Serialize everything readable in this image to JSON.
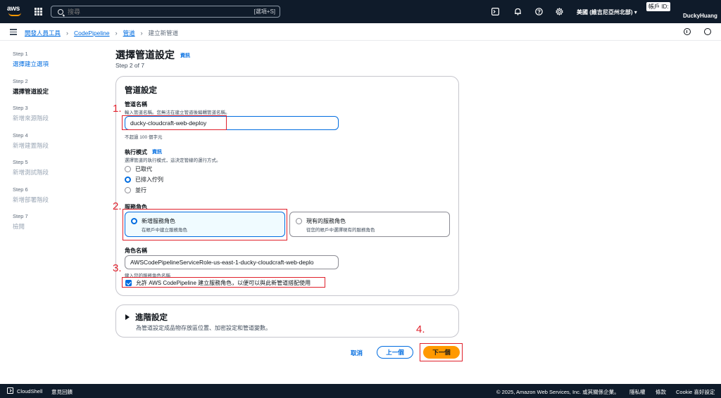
{
  "topnav": {
    "logo_text": "aws",
    "search_placeholder": "搜尋",
    "search_shortcut": "[選項+S]",
    "region": "美國 (維吉尼亞州北部) ▾",
    "account_label": "帳戶 ID:",
    "username": "DuckyHuang"
  },
  "breadcrumb": {
    "items": [
      "開發人員工具",
      "CodePipeline",
      "管道"
    ],
    "current": "建立新管道"
  },
  "steps": [
    {
      "num": "Step 1",
      "label": "選擇建立選項"
    },
    {
      "num": "Step 2",
      "label": "選擇管道設定"
    },
    {
      "num": "Step 3",
      "label": "新增來源階段"
    },
    {
      "num": "Step 4",
      "label": "新增建置階段"
    },
    {
      "num": "Step 5",
      "label": "新增測試階段"
    },
    {
      "num": "Step 6",
      "label": "新增部署階段"
    },
    {
      "num": "Step 7",
      "label": "檢閱"
    }
  ],
  "page": {
    "title": "選擇管道設定",
    "info": "資訊",
    "step_of": "Step 2 of 7"
  },
  "pipeline_settings": {
    "heading": "管道設定",
    "name_label": "管道名稱",
    "name_desc": "輸入管道名稱。您無法在建立管道後編輯管道名稱。",
    "name_value": "ducky-cloudcraft-web-deploy",
    "name_constraint": "不超過 100 個字元",
    "mode_label": "執行模式",
    "mode_info": "資訊",
    "mode_desc": "選擇管道的執行模式，這決定管線的運行方式。",
    "mode_options": [
      "已取代",
      "已排入佇列",
      "並行"
    ],
    "role_label": "服務角色",
    "role_new_title": "新增服務角色",
    "role_new_desc": "在帳戶中建立服務角色",
    "role_existing_title": "現有的服務角色",
    "role_existing_desc": "從您的帳戶中選擇現有的服務角色",
    "role_name_label": "角色名稱",
    "role_name_value": "AWSCodePipelineServiceRole-us-east-1-ducky-cloudcraft-web-deplo",
    "role_name_desc": "鍵入您的服務角色名稱",
    "allow_checkbox": "允許 AWS CodePipeline 建立服務角色，以便可以與此新管道搭配使用"
  },
  "advanced": {
    "title": "進階設定",
    "desc": "為管道設定成品物存放區位置、加密設定和管道變數。"
  },
  "actions": {
    "cancel": "取消",
    "previous": "上一個",
    "next": "下一個"
  },
  "annotations": [
    "1.",
    "2.",
    "3.",
    "4."
  ],
  "footer": {
    "cloudshell": "CloudShell",
    "feedback": "意見回饋",
    "copyright": "© 2025, Amazon Web Services, Inc. 或其關係企業。",
    "privacy": "隱私權",
    "terms": "條款",
    "cookie": "Cookie 喜好設定"
  },
  "colors": {
    "nav_bg": "#0f1b2a",
    "link": "#006ce0",
    "primary_button": "#ff9900",
    "annotation_red": "#e0202b"
  },
  "icons": [
    "grid-icon",
    "search-icon",
    "cloudshell-icon",
    "bell-icon",
    "help-icon",
    "gear-icon",
    "hamburger-icon",
    "info-icon",
    "clock-icon",
    "caret-right-icon",
    "check-icon"
  ]
}
